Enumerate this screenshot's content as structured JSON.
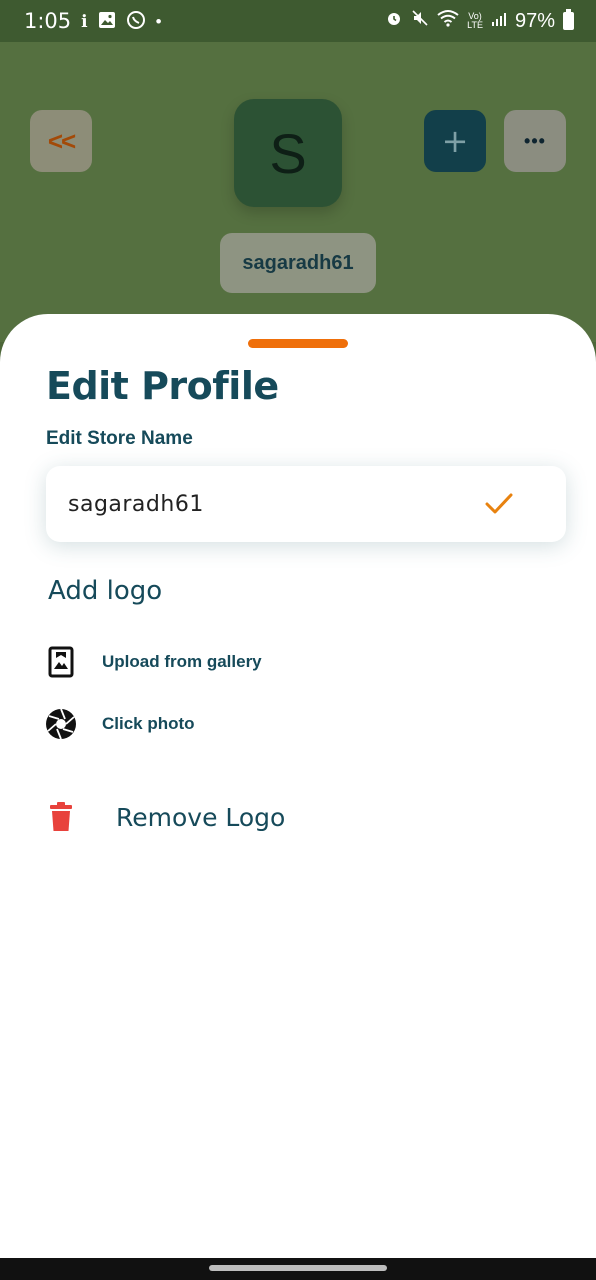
{
  "status_bar": {
    "time": "1:05",
    "battery": "97%"
  },
  "header": {
    "back_label": "<<",
    "avatar_letter": "S",
    "add_label": "+",
    "more_label": "•••",
    "store_name": "sagaradh61"
  },
  "sheet": {
    "title": "Edit Profile",
    "store_name_label": "Edit Store Name",
    "store_name_value": "sagaradh61",
    "add_logo_heading": "Add logo",
    "upload_label": "Upload from gallery",
    "camera_label": "Click photo",
    "remove_label": "Remove Logo"
  },
  "colors": {
    "accent": "#ef6f0a",
    "primary_text": "#164a5a",
    "danger": "#e8423c"
  }
}
